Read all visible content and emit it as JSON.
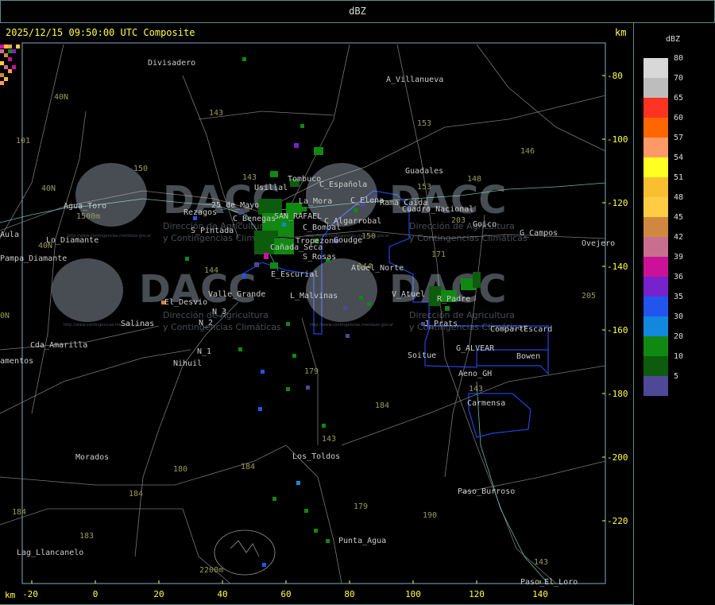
{
  "window": {
    "title": "dBZ"
  },
  "header": {
    "timestamp": "2025/12/15 09:50:00 UTC Composite",
    "km_right": "km",
    "km_bottom": "km"
  },
  "x_ticks": [
    "-20",
    "0",
    "20",
    "40",
    "60",
    "80",
    "100",
    "120",
    "140"
  ],
  "y_ticks": [
    "-80",
    "-100",
    "-120",
    "-140",
    "-160",
    "-180",
    "-200",
    "-220"
  ],
  "legend": {
    "title": "dBZ",
    "items": [
      {
        "label": "80",
        "color": "#d8d8d8"
      },
      {
        "label": "70",
        "color": "#bdbdbd"
      },
      {
        "label": "65",
        "color": "#ff3322"
      },
      {
        "label": "60",
        "color": "#ff6600"
      },
      {
        "label": "57",
        "color": "#ff9966"
      },
      {
        "label": "54",
        "color": "#ffff22"
      },
      {
        "label": "51",
        "color": "#f8c030"
      },
      {
        "label": "48",
        "color": "#ffcc44"
      },
      {
        "label": "45",
        "color": "#d08840"
      },
      {
        "label": "42",
        "color": "#c86f90"
      },
      {
        "label": "39",
        "color": "#cc1199"
      },
      {
        "label": "36",
        "color": "#7722cc"
      },
      {
        "label": "35",
        "color": "#2255ee"
      },
      {
        "label": "30",
        "color": "#1188dd"
      },
      {
        "label": "20",
        "color": "#118811"
      },
      {
        "label": "10",
        "color": "#0d5c0d"
      },
      {
        "label": "5",
        "color": "#4f4896"
      }
    ]
  },
  "places": [
    {
      "name": "Divisadero"
    },
    {
      "name": "A_Villanueva"
    },
    {
      "name": "Guadales"
    },
    {
      "name": "Usillal"
    },
    {
      "name": "Tombuco"
    },
    {
      "name": "C_Española"
    },
    {
      "name": "C_Elena"
    },
    {
      "name": "Rama_Caida"
    },
    {
      "name": "Cuadro_Nacional"
    },
    {
      "name": "La_Mora"
    },
    {
      "name": "25_de_Mayo"
    },
    {
      "name": "Rezagos"
    },
    {
      "name": "C_Benegas"
    },
    {
      "name": "SAN_RAFAEL"
    },
    {
      "name": "C_Algarrobal"
    },
    {
      "name": "C_Bombal"
    },
    {
      "name": "S_Pintada"
    },
    {
      "name": "Tropezon"
    },
    {
      "name": "Goudge"
    },
    {
      "name": "Cañada_Seca"
    },
    {
      "name": "Goico"
    },
    {
      "name": "G_Campos"
    },
    {
      "name": "Ovejero"
    },
    {
      "name": "Aula"
    },
    {
      "name": "Pampa_Diamante"
    },
    {
      "name": "Agua_Toro"
    },
    {
      "name": "Lo_Diamante"
    },
    {
      "name": "S_Rosas"
    },
    {
      "name": "Atuel_Norte"
    },
    {
      "name": "E_Escurial"
    },
    {
      "name": "Valle_Grande"
    },
    {
      "name": "L_Malvinas"
    },
    {
      "name": "V_Atuel"
    },
    {
      "name": "R_Padre"
    },
    {
      "name": "El_Desvio"
    },
    {
      "name": "N_3"
    },
    {
      "name": "N_2"
    },
    {
      "name": "Salinas"
    },
    {
      "name": "J_Prats"
    },
    {
      "name": "CompartEscard"
    },
    {
      "name": "Cda_Amarilla"
    },
    {
      "name": "G_ALVEAR"
    },
    {
      "name": "Bowen"
    },
    {
      "name": "Soitue"
    },
    {
      "name": "N_1"
    },
    {
      "name": "Nihuil"
    },
    {
      "name": "Aeno_GH"
    },
    {
      "name": "Carmensa"
    },
    {
      "name": "Morados"
    },
    {
      "name": "Los_Toldos"
    },
    {
      "name": "Paso_Burroso"
    },
    {
      "name": "Punta_Agua"
    },
    {
      "name": "Lag_Llancanelo"
    },
    {
      "name": "Paso_El_Loro"
    },
    {
      "name": "amentos"
    },
    {
      "name": "40N"
    },
    {
      "name": "143"
    },
    {
      "name": "153"
    },
    {
      "name": "146"
    },
    {
      "name": "148"
    },
    {
      "name": "150"
    },
    {
      "name": "101"
    },
    {
      "name": "1500m"
    },
    {
      "name": "203"
    },
    {
      "name": "171"
    },
    {
      "name": "144"
    },
    {
      "name": "205"
    },
    {
      "name": "179"
    },
    {
      "name": "184"
    },
    {
      "name": "180"
    },
    {
      "name": "183"
    },
    {
      "name": "190"
    },
    {
      "name": "2200m"
    },
    {
      "name": "0N"
    }
  ],
  "watermark": {
    "text": "DACC",
    "sub1": "Dirección de Agricultura",
    "sub2": "y Contingencias Climáticas",
    "url": "http://www.contingencias.mendoza.gov.ar"
  }
}
